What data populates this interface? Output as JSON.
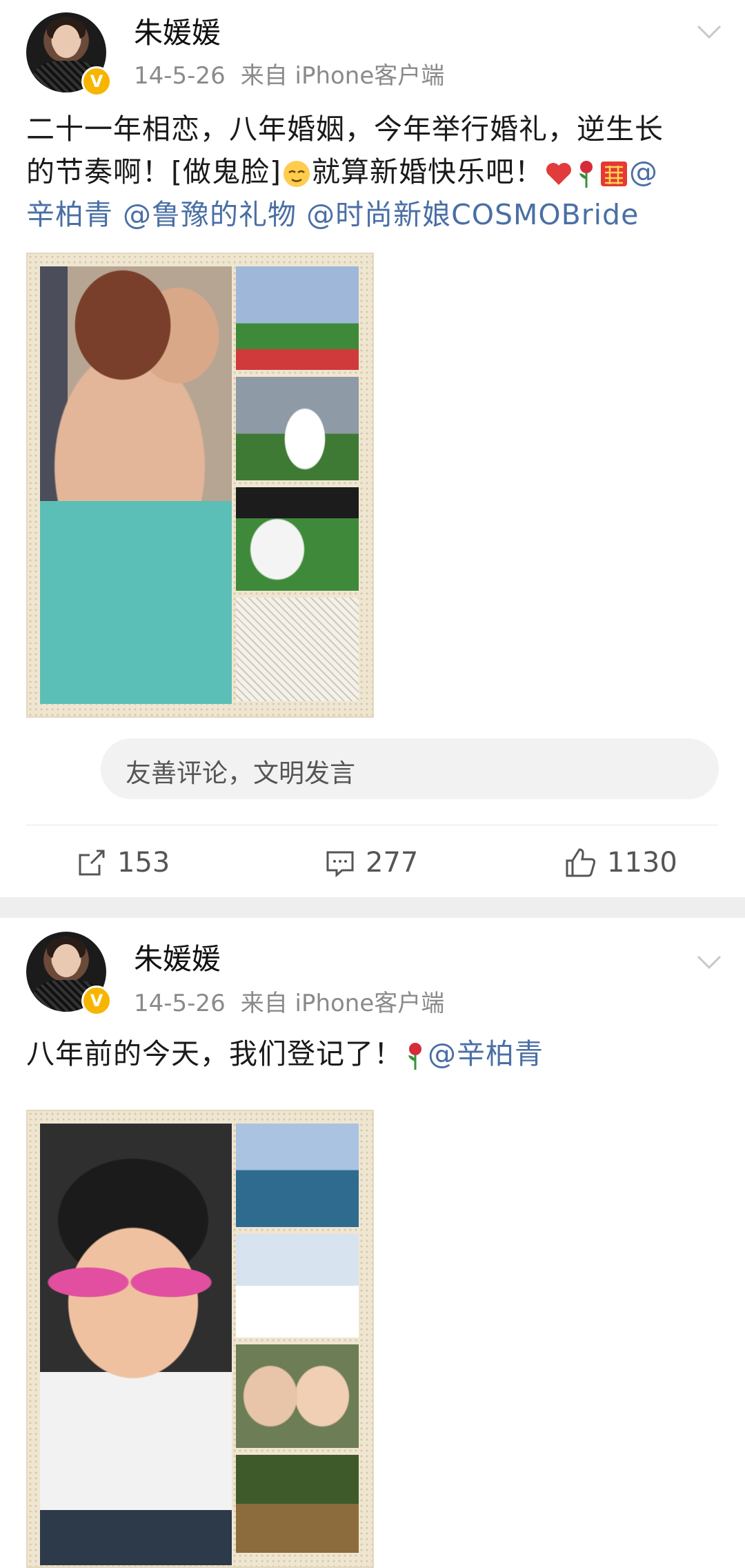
{
  "posts": [
    {
      "author": "朱媛媛",
      "date": "14-5-26",
      "source": "来自 iPhone客户端",
      "text_line1": "二十一年相恋，八年婚姻，今年举行婚礼，逆生长",
      "text_line2_a": "的节奏啊！[做鬼脸]",
      "text_line2_b": "就算新婚快乐吧！",
      "text_line2_c": "@",
      "mention1": "辛柏青",
      "mention2": "@鲁豫的礼物",
      "mention3": "@时尚新娘COSMOBride",
      "comment_placeholder": "友善评论，文明发言",
      "reposts": "153",
      "comments": "277",
      "likes": "1130",
      "icons": [
        "verified-badge-icon",
        "chevron-down-icon",
        "smirk-emoji-icon",
        "heart-emoji-icon",
        "rose-emoji-icon",
        "double-happiness-emoji-icon",
        "repost-icon",
        "comment-icon",
        "like-icon"
      ]
    },
    {
      "author": "朱媛媛",
      "date": "14-5-26",
      "source": "来自 iPhone客户端",
      "text_a": "八年前的今天，我们登记了！",
      "mention1": "@辛柏青",
      "icons": [
        "verified-badge-icon",
        "chevron-down-icon",
        "rose-emoji-icon"
      ]
    }
  ],
  "colors": {
    "mention": "#4a6fa5",
    "meta": "#8a8a8a",
    "badge": "#f7b500",
    "separator": "#eeeeee"
  }
}
